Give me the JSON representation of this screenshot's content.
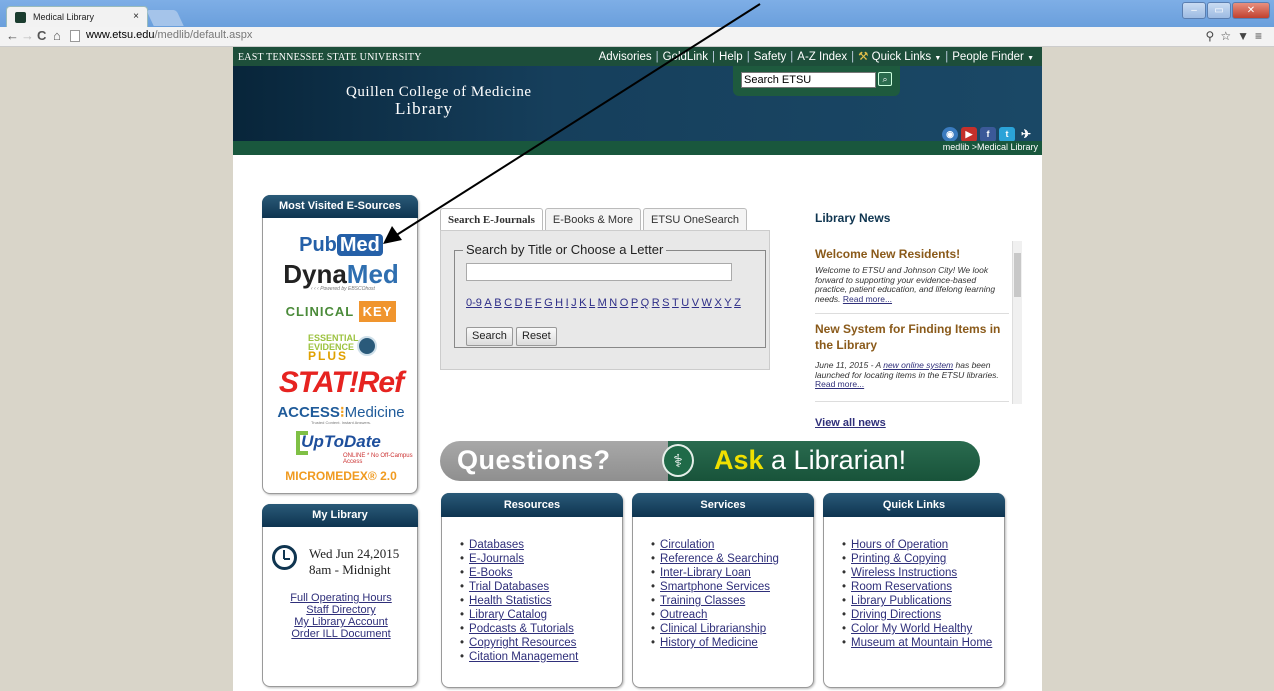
{
  "browser": {
    "tab_title": "Medical Library",
    "tab_close": "×",
    "url_host": "www.etsu.edu",
    "url_path": "/medlib/default.aspx"
  },
  "topbar": {
    "university": "EAST TENNESSEE STATE UNIVERSITY",
    "links": [
      "Advisories",
      "GoldLink",
      "Help",
      "Safety",
      "A-Z Index",
      "Quick Links",
      "People Finder"
    ]
  },
  "header": {
    "college": "Quillen College of Medicine",
    "library": "Library",
    "search_value": "Search ETSU",
    "breadcrumb": "medlib >Medical Library"
  },
  "most_visited": {
    "title": "Most Visited E-Sources",
    "pubmed_pub": "Pub",
    "pubmed_med": "Med",
    "dynamed_a": "Dyna",
    "dynamed_b": "Med",
    "dynamed_sub": "‹ ‹ ‹  Powered by EBSCOhost",
    "clinical_a": "CLINICAL",
    "clinical_b": "KEY",
    "eep_a": "ESSENTIAL",
    "eep_b": "EVIDENCE",
    "eep_c": "PLUS",
    "statref": "STAT!Ref",
    "access_a": "ACCESS",
    "access_b": "Medicine",
    "access_sub": "Trusted Content. Instant Answers.",
    "uptodate": "UpToDate",
    "uptodate_sub": "ONLINE * No Off-Campus Access",
    "micromedex": "MICROMEDEX® 2.0"
  },
  "my_library": {
    "title": "My Library",
    "date": "Wed Jun 24,2015",
    "hours": "8am - Midnight",
    "links": [
      "Full Operating Hours",
      "Staff Directory",
      "My Library Account",
      "Order ILL Document"
    ]
  },
  "search": {
    "tabs": [
      "Search E-Journals",
      "E-Books & More",
      "ETSU OneSearch"
    ],
    "legend": "Search by Title or Choose a Letter",
    "input_value": "",
    "letters": [
      "0-9",
      "A",
      "B",
      "C",
      "D",
      "E",
      "F",
      "G",
      "H",
      "I",
      "J",
      "K",
      "L",
      "M",
      "N",
      "O",
      "P",
      "Q",
      "R",
      "S",
      "T",
      "U",
      "V",
      "W",
      "X",
      "Y",
      "Z"
    ],
    "search_btn": "Search",
    "reset_btn": "Reset"
  },
  "news": {
    "title": "Library News",
    "items": [
      {
        "heading": "Welcome New Residents!",
        "body": "Welcome to ETSU and Johnson City! We look forward to supporting your evidence-based practice, patient education, and lifelong learning needs. ",
        "more": "Read more..."
      },
      {
        "heading": "New System for Finding Items in the Library",
        "body_a": "June 11, 2015 - A ",
        "link": "new online system",
        "body_b": " has been launched for locating items in the ETSU libraries. ",
        "more": "Read more..."
      }
    ],
    "view_all": "View all news"
  },
  "banner": {
    "questions": "Questions?",
    "ask": "Ask",
    "rest": " a Librarian!"
  },
  "columns": {
    "resources": {
      "title": "Resources",
      "items": [
        "Databases",
        "E-Journals",
        "E-Books",
        "Trial Databases",
        "Health Statistics",
        "Library Catalog",
        "Podcasts & Tutorials",
        "Copyright Resources",
        "Citation Management"
      ]
    },
    "services": {
      "title": "Services",
      "items": [
        "Circulation",
        "Reference & Searching",
        "Inter-Library Loan",
        "Smartphone Services",
        "Training Classes",
        "Outreach",
        "Clinical Librarianship",
        "History of Medicine"
      ]
    },
    "quicklinks": {
      "title": "Quick Links",
      "items": [
        "Hours of Operation",
        "Printing & Copying",
        "Wireless Instructions",
        "Room Reservations",
        "Library Publications",
        "Driving Directions",
        "Color My World Healthy",
        "Museum at Mountain Home"
      ]
    }
  },
  "colors": {
    "etsu_green": "#1d4e3a",
    "header_blue": "#0e3450",
    "link": "#2f2f7a",
    "ask_yellow": "#f0e000"
  }
}
